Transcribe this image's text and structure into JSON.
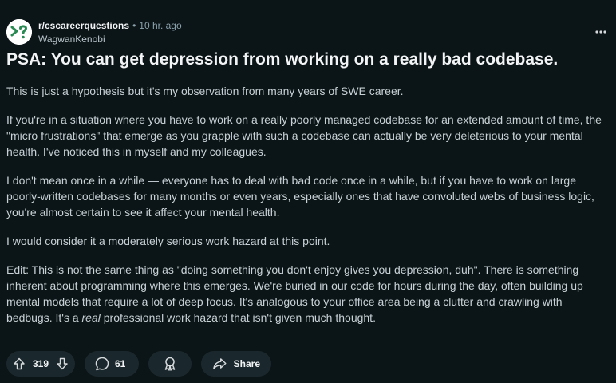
{
  "header": {
    "subreddit": "r/cscareerquestions",
    "separator": "•",
    "time": "10 hr. ago",
    "author": "WagwanKenobi",
    "avatar_symbol": ">?",
    "avatar_color": "#2b8a53"
  },
  "menu": {
    "icon": "overflow-menu-icon"
  },
  "post": {
    "title": "PSA: You can get depression from working on a really bad codebase.",
    "paragraphs": [
      "This is just a hypothesis but it's my observation from many years of SWE career.",
      "If you're in a situation where you have to work on a really poorly managed codebase for an extended amount of time, the \"micro frustrations\" that emerge as you grapple with such a codebase can actually be very deleterious to your mental health. I've noticed this in myself and my colleagues.",
      "I don't mean once in a while — everyone has to deal with bad code once in a while, but if you have to work on large poorly-written codebases for many months or even years, especially ones that have convoluted webs of business logic, you're almost certain to see it affect your mental health.",
      "I would consider it a moderately serious work hazard at this point."
    ],
    "edit_before": "Edit: This is not the same thing as \"doing something you don't enjoy gives you depression, duh\". There is something inherent about programming where this emerges. We're buried in our code for hours during the day, often building up mental models that require a lot of deep focus. It's analogous to your office area being a clutter and crawling with bedbugs. It's a ",
    "edit_emphasis": "real",
    "edit_after": " professional work hazard that isn't given much thought."
  },
  "actions": {
    "votes": "319",
    "comments": "61",
    "share_label": "Share"
  },
  "colors": {
    "background": "#0b1416",
    "pill_background": "#1a282d",
    "title": "#f2f4f5",
    "body_text": "#c7d1d6",
    "muted": "#8ba2ad"
  }
}
